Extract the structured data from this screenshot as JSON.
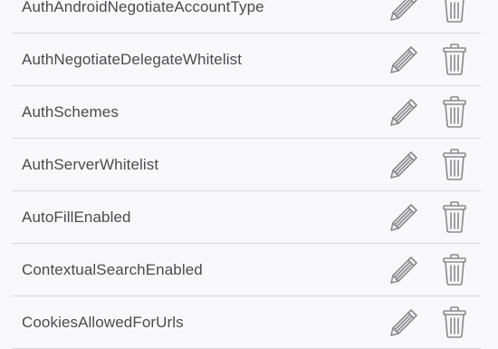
{
  "policies": {
    "items": [
      {
        "label": "AuthAndroidNegotiateAccountType",
        "edit_icon": "pencil-icon",
        "delete_icon": "trash-icon"
      },
      {
        "label": "AuthNegotiateDelegateWhitelist",
        "edit_icon": "pencil-icon",
        "delete_icon": "trash-icon"
      },
      {
        "label": "AuthSchemes",
        "edit_icon": "pencil-icon",
        "delete_icon": "trash-icon"
      },
      {
        "label": "AuthServerWhitelist",
        "edit_icon": "pencil-icon",
        "delete_icon": "trash-icon"
      },
      {
        "label": "AutoFillEnabled",
        "edit_icon": "pencil-icon",
        "delete_icon": "trash-icon"
      },
      {
        "label": "ContextualSearchEnabled",
        "edit_icon": "pencil-icon",
        "delete_icon": "trash-icon"
      },
      {
        "label": "CookiesAllowedForUrls",
        "edit_icon": "pencil-icon",
        "delete_icon": "trash-icon"
      }
    ]
  },
  "colors": {
    "background": "#f8f7f9",
    "text": "#4b4b4f",
    "icon": "#8a8a8e",
    "divider": "#d9d8dc"
  }
}
